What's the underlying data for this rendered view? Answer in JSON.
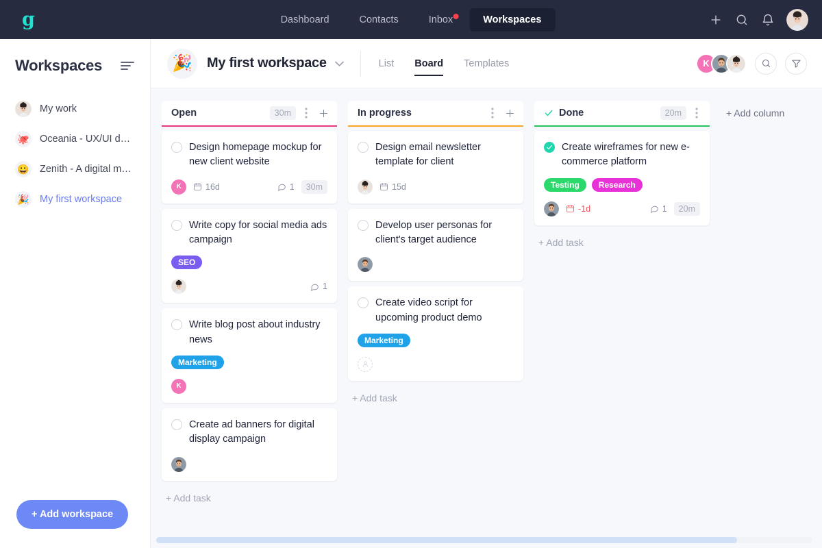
{
  "brand": {
    "logo_text": "g",
    "logo_color": "#1fe3d0"
  },
  "topbar": {
    "nav": [
      {
        "label": "Dashboard",
        "active": false,
        "badge": false
      },
      {
        "label": "Contacts",
        "active": false,
        "badge": false
      },
      {
        "label": "Inbox",
        "active": false,
        "badge": true
      },
      {
        "label": "Workspaces",
        "active": true,
        "badge": false
      }
    ],
    "actions": [
      {
        "name": "add-icon",
        "label": "Add"
      },
      {
        "name": "search-icon",
        "label": "Search"
      },
      {
        "name": "notifications-bell-icon",
        "label": "Notifications"
      }
    ],
    "user_avatar": "user-avatar"
  },
  "sidebar": {
    "title": "Workspaces",
    "collapse_icon": "collapse-sidebar-icon",
    "items": [
      {
        "label": "My work",
        "emoji": "",
        "avatar": "photo-woman",
        "active": false
      },
      {
        "label": "Oceania - UX/UI desig...",
        "emoji": "🐙",
        "active": false
      },
      {
        "label": "Zenith - A digital mark...",
        "emoji": "😀",
        "active": false
      },
      {
        "label": "My first workspace",
        "emoji": "🎉",
        "active": true
      }
    ],
    "add_workspace_label": "+ Add workspace",
    "add_workspace_color": "#6d89f5"
  },
  "workspace_header": {
    "emoji": "🎉",
    "name": "My first workspace",
    "chevron_icon": "chevron-down-icon",
    "tabs": [
      {
        "label": "List",
        "active": false
      },
      {
        "label": "Board",
        "active": true
      },
      {
        "label": "Templates",
        "active": false
      }
    ],
    "members": [
      {
        "initial": "K",
        "color": "#f472b6",
        "type": "initial"
      },
      {
        "type": "photo-man"
      },
      {
        "type": "photo-woman"
      }
    ],
    "search_icon": "search-icon",
    "filter_icon": "filter-icon"
  },
  "board": {
    "add_column_label": "+ Add column",
    "add_task_label": "+ Add task",
    "columns": [
      {
        "title": "Open",
        "accent": "#e8367f",
        "time_badge": "30m",
        "checked": false,
        "has_add": true,
        "has_kebab": true,
        "show_add_task": true,
        "cards": [
          {
            "title": "Design homepage mockup for new client website",
            "checked": false,
            "tags": [],
            "avatar": {
              "type": "initial",
              "initial": "K",
              "color": "#f472b6"
            },
            "due": "16d",
            "overdue": false,
            "comments": "1",
            "time": "30m"
          },
          {
            "title": "Write copy for social media ads campaign",
            "checked": false,
            "tags": [
              {
                "label": "SEO",
                "color": "#7b5cf0"
              }
            ],
            "avatar": {
              "type": "photo-woman"
            },
            "due": "",
            "overdue": false,
            "comments": "1",
            "time": ""
          },
          {
            "title": "Write blog post about industry news",
            "checked": false,
            "tags": [
              {
                "label": "Marketing",
                "color": "#1fa2e8"
              }
            ],
            "avatar": {
              "type": "initial",
              "initial": "K",
              "color": "#f472b6"
            },
            "due": "",
            "overdue": false,
            "comments": "",
            "time": ""
          },
          {
            "title": "Create ad banners for digital display campaign",
            "checked": false,
            "tags": [],
            "avatar": {
              "type": "photo-man"
            },
            "due": "",
            "overdue": false,
            "comments": "",
            "time": ""
          }
        ]
      },
      {
        "title": "In progress",
        "accent": "#f5a623",
        "time_badge": "",
        "checked": false,
        "has_add": true,
        "has_kebab": true,
        "show_add_task": true,
        "cards": [
          {
            "title": "Design email newsletter template for client",
            "checked": false,
            "tags": [],
            "avatar": {
              "type": "photo-woman"
            },
            "due": "15d",
            "overdue": false,
            "comments": "",
            "time": ""
          },
          {
            "title": "Develop user personas for client's target audience",
            "checked": false,
            "tags": [],
            "avatar": {
              "type": "photo-man"
            },
            "due": "",
            "overdue": false,
            "comments": "",
            "time": ""
          },
          {
            "title": "Create video script for upcoming product demo",
            "checked": false,
            "tags": [
              {
                "label": "Marketing",
                "color": "#1fa2e8"
              }
            ],
            "avatar": {
              "type": "empty"
            },
            "due": "",
            "overdue": false,
            "comments": "",
            "time": ""
          }
        ]
      },
      {
        "title": "Done",
        "accent": "#22c55e",
        "time_badge": "20m",
        "checked": true,
        "has_add": false,
        "has_kebab": true,
        "show_add_task": true,
        "cards": [
          {
            "title": "Create wireframes for new e-commerce platform",
            "checked": true,
            "tags": [
              {
                "label": "Testing",
                "color": "#2bd96b"
              },
              {
                "label": "Research",
                "color": "#e832d8"
              }
            ],
            "avatar": {
              "type": "photo-man"
            },
            "due": "-1d",
            "overdue": true,
            "comments": "1",
            "time": "20m"
          }
        ]
      }
    ]
  },
  "scrollbar": {
    "thumb_percent": "88.5%"
  }
}
